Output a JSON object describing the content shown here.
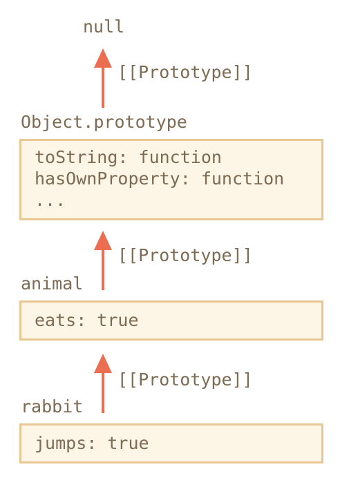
{
  "colors": {
    "text": "#7e6b53",
    "box_fill": "#fdf5e5",
    "box_border": "#e9c792",
    "arrow": "#ea6e4f"
  },
  "null_label": "null",
  "proto_label": "[[Prototype]]",
  "objects": {
    "object_prototype": {
      "name": "Object.prototype",
      "lines": [
        "toString: function",
        "hasOwnProperty: function",
        "..."
      ]
    },
    "animal": {
      "name": "animal",
      "lines": [
        "eats: true"
      ]
    },
    "rabbit": {
      "name": "rabbit",
      "lines": [
        "jumps: true"
      ]
    }
  }
}
